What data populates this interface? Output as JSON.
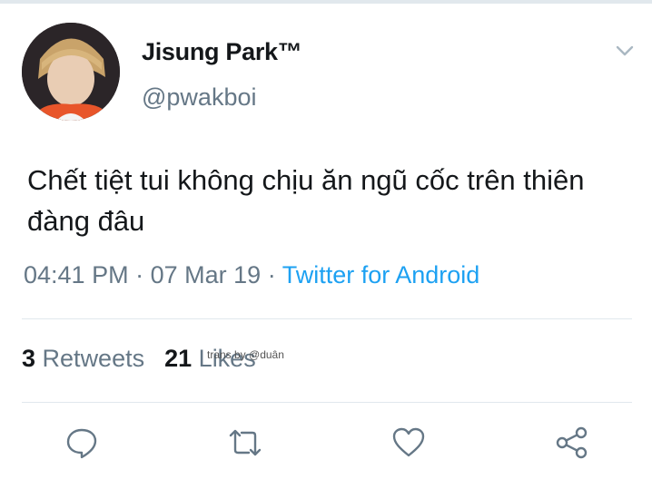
{
  "user": {
    "display_name": "Jisung Park™",
    "handle": "@pwakboi"
  },
  "tweet": {
    "text": "Chết tiệt tui không chịu ăn ngũ cốc trên thiên đàng đâu",
    "time": "04:41 PM",
    "separator": "·",
    "date": "07 Mar 19",
    "source": "Twitter for Android"
  },
  "stats": {
    "retweets_count": "3",
    "retweets_label": "Retweets",
    "likes_count": "21",
    "likes_label": "Likes"
  },
  "watermark": "trans by @duân",
  "icons": {
    "caret": "chevron-down-icon",
    "reply": "reply-icon",
    "retweet": "retweet-icon",
    "like": "heart-icon",
    "share": "share-icon"
  },
  "colors": {
    "text": "#14171a",
    "secondary": "#657786",
    "link": "#1da1f2",
    "divider": "#e1e8ed"
  }
}
